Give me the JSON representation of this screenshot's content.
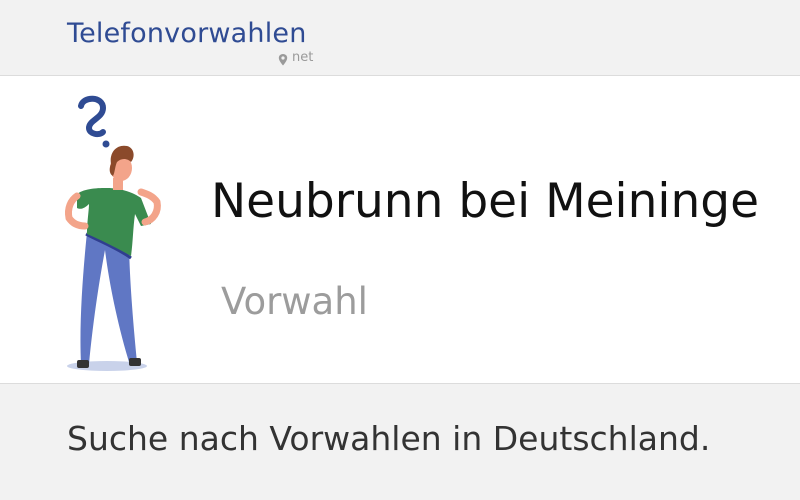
{
  "header": {
    "logo_text": "Telefonvorwahlen",
    "logo_suffix": "net",
    "logo_icon": "location-pin-icon"
  },
  "hero": {
    "title": "Neubrunn bei Meininge",
    "subtitle": "Vorwahl",
    "illustration": "thinking-person-with-question-mark"
  },
  "footer": {
    "text": "Suche nach Vorwahlen in Deutschland."
  },
  "colors": {
    "brand": "#2f4b93",
    "shirt": "#3a8b4f",
    "pants": "#6077c4",
    "hair": "#8b4a2b",
    "skin": "#f3a48a"
  }
}
